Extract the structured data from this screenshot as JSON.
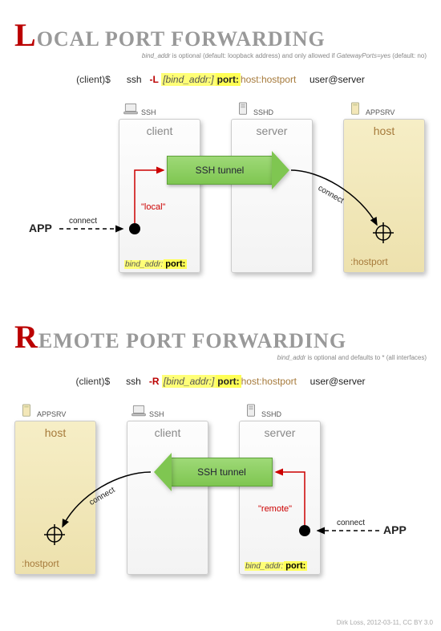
{
  "local": {
    "title_first": "L",
    "title_rest": "ocal Port Forwarding",
    "subnote_pre": "bind_addr",
    "subnote_mid": " is optional (default: loopback address) and only allowed if ",
    "subnote_gw": "GatewayPorts=yes",
    "subnote_post": " (default: no)",
    "cmd_prompt": "(client)$",
    "cmd_ssh": "ssh",
    "cmd_flag": "-L",
    "cmd_bind": "[bind_addr:]",
    "cmd_port": "port:",
    "cmd_hp": "host:hostport",
    "cmd_user": "user@server",
    "dev_client": "SSH",
    "dev_server": "SSHD",
    "dev_host": "APPSRV",
    "box_client": "client",
    "box_server": "server",
    "box_host": "host",
    "tunnel": "SSH tunnel",
    "app": "APP",
    "connect": "connect",
    "local_label": "\"local\"",
    "hostport": ":hostport",
    "port_bind": "bind_addr:",
    "port_port": "port:"
  },
  "remote": {
    "title_first": "R",
    "title_rest": "emote Port Forwarding",
    "subnote_pre": "bind_addr",
    "subnote_post": " is optional and defaults to * (all interfaces)",
    "cmd_prompt": "(client)$",
    "cmd_ssh": "ssh",
    "cmd_flag": "-R",
    "cmd_bind": "[bind_addr:]",
    "cmd_port": "port:",
    "cmd_hp": "host:hostport",
    "cmd_user": "user@server",
    "dev_client": "SSH",
    "dev_server": "SSHD",
    "dev_host": "APPSRV",
    "box_client": "client",
    "box_server": "server",
    "box_host": "host",
    "tunnel": "SSH tunnel",
    "app": "APP",
    "connect": "connect",
    "remote_label": "\"remote\"",
    "hostport": ":hostport",
    "port_bind": "bind_addr:",
    "port_port": "port:"
  },
  "footer": "Dirk Loss, 2012-03-11, CC BY 3.0"
}
